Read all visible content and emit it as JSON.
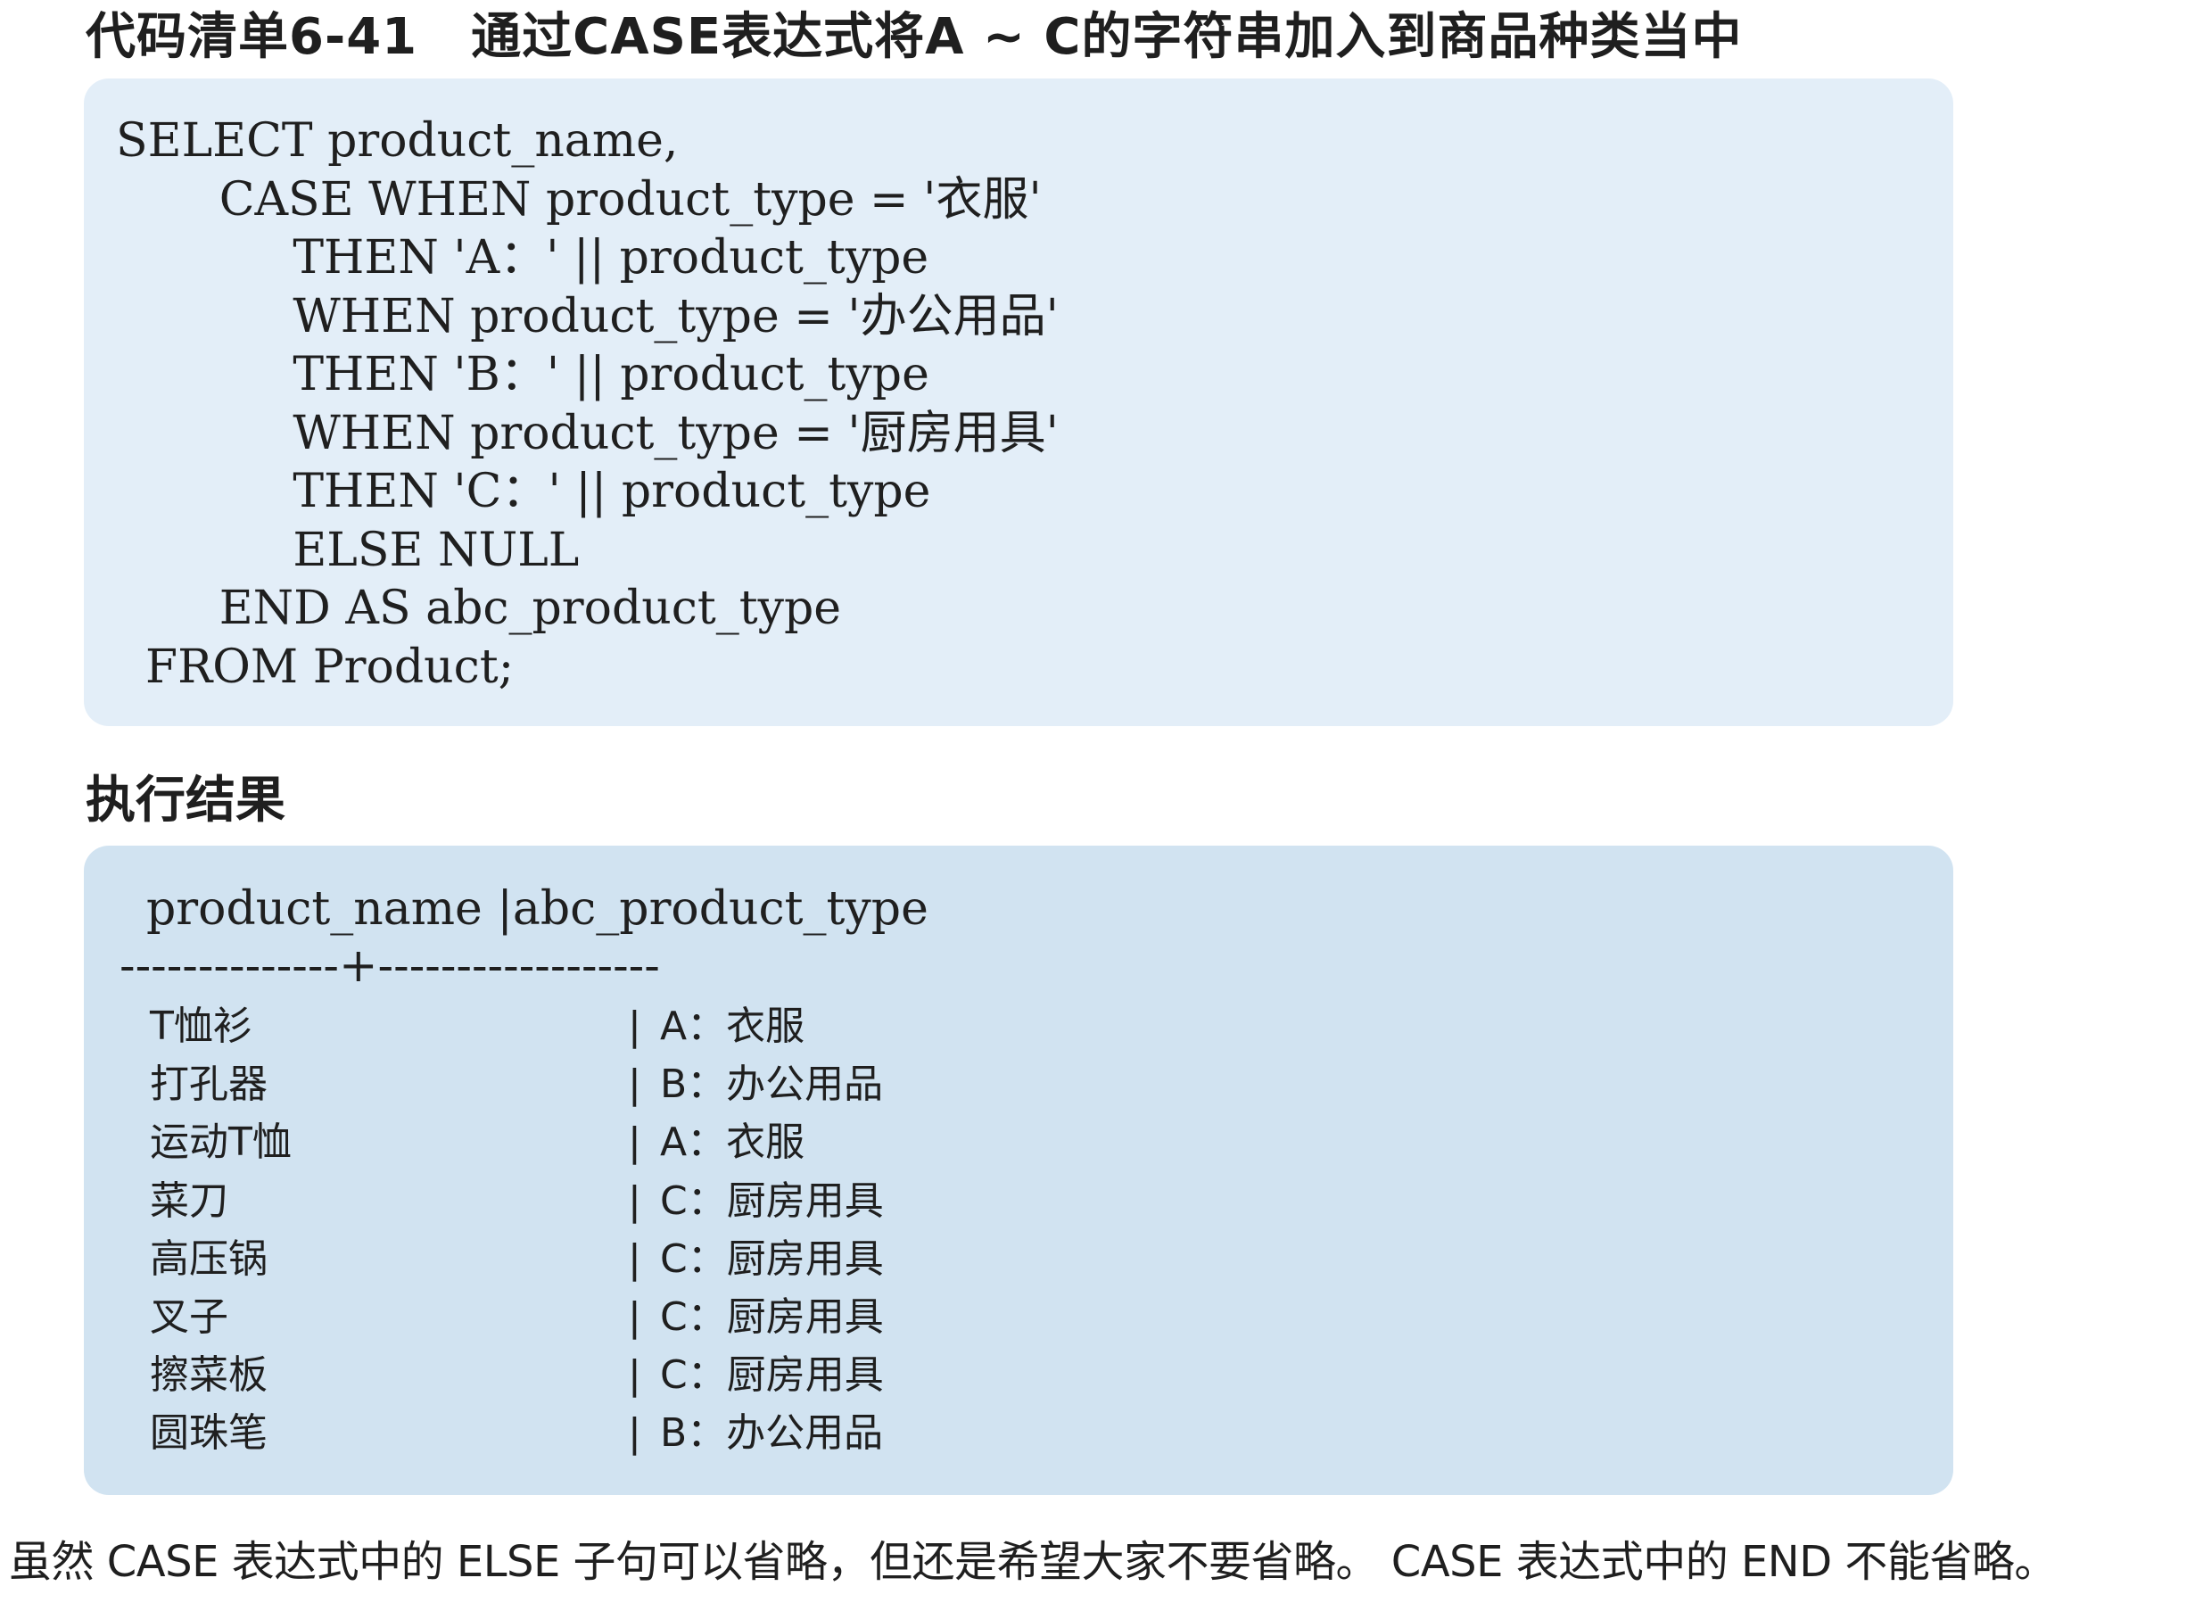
{
  "listing": {
    "number": "代码清单6-41",
    "caption": "通过CASE表达式将A ~ C的字符串加入到商品种类当中"
  },
  "code": {
    "lines": [
      "SELECT product_name,",
      "       CASE WHEN product_type = '衣服'",
      "            THEN 'A：' || product_type",
      "            WHEN product_type = '办公用品'",
      "            THEN 'B：' || product_type",
      "            WHEN product_type = '厨房用具'",
      "            THEN 'C：' || product_type",
      "            ELSE NULL",
      "       END AS abc_product_type",
      "  FROM Product;"
    ]
  },
  "result": {
    "heading": "执行结果",
    "header": "product_name |abc_product_type",
    "rule": "--------------+------------------",
    "separator": "|",
    "rows": [
      {
        "name": "T恤衫",
        "type": "A：衣服"
      },
      {
        "name": "打孔器",
        "type": "B：办公用品"
      },
      {
        "name": "运动T恤",
        "type": "A：衣服"
      },
      {
        "name": "菜刀",
        "type": "C：厨房用具"
      },
      {
        "name": "高压锅",
        "type": "C：厨房用具"
      },
      {
        "name": "叉子",
        "type": "C：厨房用具"
      },
      {
        "name": "擦菜板",
        "type": "C：厨房用具"
      },
      {
        "name": "圆珠笔",
        "type": "B：办公用品"
      }
    ]
  },
  "footnote": "虽然 CASE 表达式中的 ELSE 子句可以省略，但还是希望大家不要省略。 CASE 表达式中的 END 不能省略。"
}
